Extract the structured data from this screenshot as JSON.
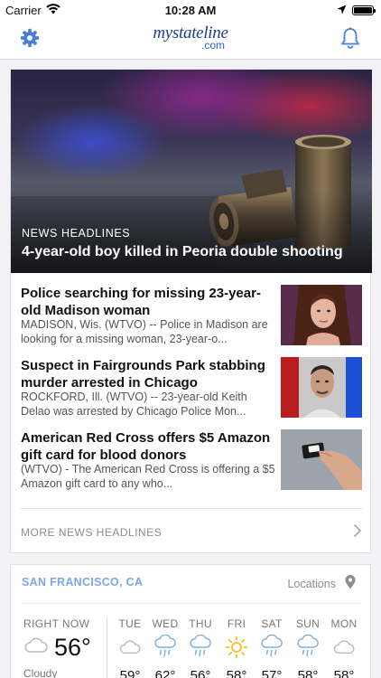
{
  "status": {
    "carrier": "Carrier",
    "time": "10:28 AM"
  },
  "nav": {
    "logo_main": "mystateline",
    "logo_sub": ".com"
  },
  "hero": {
    "kicker": "NEWS HEADLINES",
    "title": "4-year-old boy killed in Peoria double shooting"
  },
  "stories": [
    {
      "title": "Police searching for missing 23-year-old Madison woman",
      "desc": "MADISON, Wis. (WTVO) -- Police in Madison are looking for a missing woman, 23-year-o..."
    },
    {
      "title": "Suspect in Fairgrounds Park stabbing murder arrested in Chicago",
      "desc": "ROCKFORD, Ill. (WTVO) -- 23-year-old Keith Delao was arrested by Chicago Police Mon..."
    },
    {
      "title": "American Red Cross offers $5 Amazon gift card for blood donors",
      "desc": "(WTVO) - The American Red Cross is offering a $5 Amazon gift card to any who..."
    }
  ],
  "more": {
    "label": "MORE NEWS HEADLINES"
  },
  "weather": {
    "location": "SAN FRANCISCO, CA",
    "locations_label": "Locations",
    "now": {
      "label": "RIGHT NOW",
      "temp": "56°",
      "condition": "Cloudy",
      "icon": "cloud-icon"
    },
    "days": [
      {
        "name": "TUE",
        "temp": "59°",
        "icon": "cloud-icon"
      },
      {
        "name": "WED",
        "temp": "62°",
        "icon": "rain-icon"
      },
      {
        "name": "THU",
        "temp": "56°",
        "icon": "rain-icon"
      },
      {
        "name": "FRI",
        "temp": "58°",
        "icon": "sun-icon"
      },
      {
        "name": "SAT",
        "temp": "57°",
        "icon": "rain-icon"
      },
      {
        "name": "SUN",
        "temp": "58°",
        "icon": "rain-icon"
      },
      {
        "name": "MON",
        "temp": "58°",
        "icon": "cloud-icon"
      }
    ]
  },
  "colors": {
    "accent": "#4a7fd6",
    "logo": "#1f3d8c",
    "location": "#7aa7e6",
    "sun": "#f2c21b"
  }
}
